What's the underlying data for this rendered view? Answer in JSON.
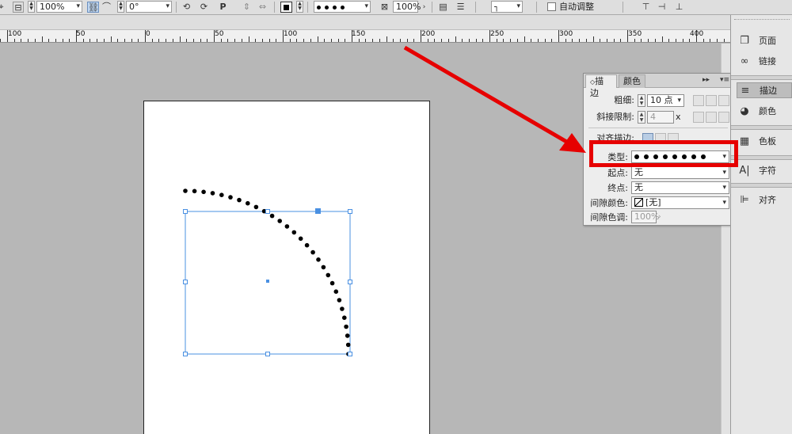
{
  "control_bar": {
    "scale_value": "100%",
    "rotation_value": "0°",
    "zoom_value": "100%",
    "auto_fit_label": "自动调整"
  },
  "ruler": {
    "labels": [
      "100",
      "50",
      "0",
      "50",
      "100",
      "150",
      "200",
      "250",
      "300",
      "350",
      "400"
    ]
  },
  "stroke_panel": {
    "tabs": [
      "描边",
      "颜色"
    ],
    "weight_label": "粗细:",
    "weight_value": "10 点",
    "miter_label": "斜接限制:",
    "miter_value": "4",
    "miter_unit": "x",
    "align_label": "对齐描边:",
    "type_label": "类型:",
    "start_label": "起点:",
    "start_value": "无",
    "end_label": "终点:",
    "end_value": "无",
    "gap_color_label": "间隙颜色:",
    "gap_color_value": "[无]",
    "gap_tint_label": "间隙色调:",
    "gap_tint_value": "100%"
  },
  "dock": {
    "items": [
      {
        "label": "页面",
        "icon": "pages-icon"
      },
      {
        "label": "链接",
        "icon": "links-icon"
      },
      {
        "label": "描边",
        "icon": "stroke-icon"
      },
      {
        "label": "颜色",
        "icon": "color-icon"
      },
      {
        "label": "色板",
        "icon": "swatches-icon"
      },
      {
        "label": "字符",
        "icon": "character-icon"
      },
      {
        "label": "对齐",
        "icon": "align-icon"
      }
    ]
  },
  "colors": {
    "highlight": "#e60000",
    "selection": "#4a90e2",
    "canvas": "#b7b7b7"
  }
}
